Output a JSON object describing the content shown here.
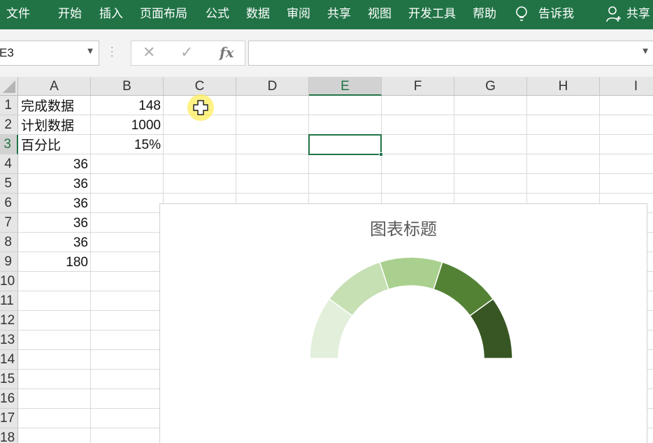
{
  "ribbon": {
    "tabs": [
      "文件",
      "开始",
      "插入",
      "页面布局",
      "公式",
      "数据",
      "审阅",
      "共享",
      "视图",
      "开发工具",
      "帮助"
    ],
    "tell_me": "告诉我",
    "share": "共享",
    "background": "#217346"
  },
  "formula_bar": {
    "name_box": "E3",
    "fx_label": "fx",
    "cancel_symbol": "✕",
    "enter_symbol": "✓",
    "formula": ""
  },
  "sheet": {
    "columns": [
      "A",
      "B",
      "C",
      "D",
      "E",
      "F",
      "G",
      "H",
      "I"
    ],
    "selected_column": "E",
    "rows": [
      "1",
      "2",
      "3",
      "4",
      "5",
      "6",
      "7",
      "8",
      "9",
      "10",
      "11",
      "12",
      "13",
      "14",
      "15",
      "16",
      "17",
      "18"
    ],
    "selected_row": "3",
    "cells": {
      "A1": "完成数据",
      "B1": "148",
      "A2": "计划数据",
      "B2": "1000",
      "A3": "百分比",
      "B3": "15%",
      "A4": "36",
      "A5": "36",
      "A6": "36",
      "A7": "36",
      "A8": "36",
      "A9": "180"
    }
  },
  "chart_data": {
    "type": "pie",
    "title": "图表标题",
    "values": [
      36,
      36,
      36,
      36,
      36,
      180
    ],
    "colors": [
      "#e2efda",
      "#c6e0b4",
      "#a9d08e",
      "#548235",
      "#375623",
      "#ffffff"
    ],
    "note_hidden_slice_index": 5
  }
}
